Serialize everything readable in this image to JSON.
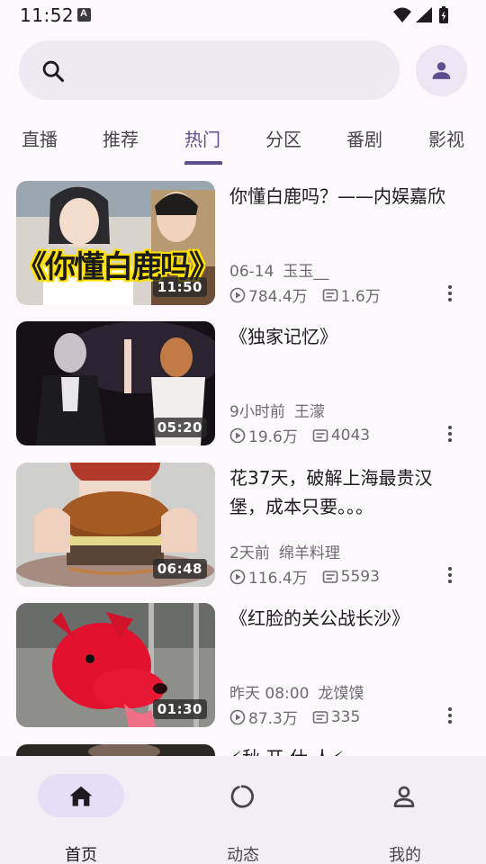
{
  "status_bar": {
    "time": "11:52",
    "icons": [
      "keyboard-a-icon",
      "wifi-icon",
      "signal-icon",
      "battery-charging-icon"
    ]
  },
  "search": {
    "placeholder": ""
  },
  "tabs": [
    {
      "label": "直播"
    },
    {
      "label": "推荐"
    },
    {
      "label": "热门",
      "active": true
    },
    {
      "label": "分区"
    },
    {
      "label": "番剧"
    },
    {
      "label": "影视"
    }
  ],
  "videos": [
    {
      "title": "你懂白鹿吗？——内娱嘉欣",
      "date": "06-14",
      "author": "玉玉__",
      "views": "784.4万",
      "comments": "1.6万",
      "duration": "11:50",
      "thumb_text": "《你懂白鹿吗》"
    },
    {
      "title": "《独家记忆》",
      "date": "9小时前",
      "author": "王濛",
      "views": "19.6万",
      "comments": "4043",
      "duration": "05:20"
    },
    {
      "title": "花37天，破解上海最贵汉堡，成本只要。。。",
      "date": "2天前",
      "author": "绵羊料理",
      "views": "116.4万",
      "comments": "5593",
      "duration": "06:48"
    },
    {
      "title": "《红脸的关公战长沙》",
      "date": "昨天 08:00",
      "author": "龙馍馍",
      "views": "87.3万",
      "comments": "335",
      "duration": "01:30"
    },
    {
      "title": "⚡秋 开 仕 人⚡",
      "date": "",
      "author": "",
      "views": "",
      "comments": "",
      "duration": ""
    }
  ],
  "bottom_nav": [
    {
      "label": "首页",
      "icon": "home-icon",
      "active": true
    },
    {
      "label": "动态",
      "icon": "dynamic-icon"
    },
    {
      "label": "我的",
      "icon": "profile-icon"
    }
  ],
  "colors": {
    "accent": "#5e4f8c",
    "background": "#fdf8fc",
    "nav_background": "#f3edf5"
  }
}
